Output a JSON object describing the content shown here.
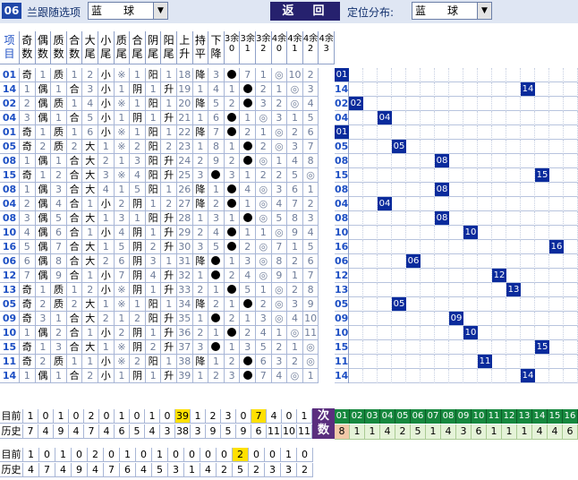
{
  "toolbar": {
    "num": "06",
    "follow_label": "兰跟随选项",
    "follow_value": "蓝　　球",
    "back": "返　回",
    "pos_label": "定位分布:",
    "pos_value": "蓝　　球"
  },
  "headers": {
    "item": "项目",
    "cols": [
      "奇数",
      "偶数",
      "质数",
      "合数",
      "大尾",
      "小尾",
      "质尾",
      "合尾",
      "阴尾",
      "阳尾",
      "上升",
      "持平",
      "下降",
      "3余0",
      "3余1",
      "3余2",
      "4余0",
      "4余1",
      "4余2",
      "4余3"
    ],
    "right_item": "项目",
    "nums": [
      "01",
      "02",
      "03",
      "04",
      "05",
      "06",
      "07",
      "08",
      "09",
      "10",
      "11",
      "12",
      "13",
      "14",
      "15",
      "16"
    ]
  },
  "rows": [
    {
      "n": "01",
      "v": [
        "奇",
        "1",
        "质",
        "1",
        "2",
        "小",
        "※",
        "1",
        "阳",
        "1",
        "18",
        "降",
        "3",
        "●",
        "7",
        "1",
        "◎",
        "10",
        "2"
      ],
      "m": 1
    },
    {
      "n": "14",
      "v": [
        "1",
        "偶",
        "1",
        "合",
        "3",
        "小",
        "1",
        "阴",
        "1",
        "升",
        "19",
        "1",
        "4",
        "1",
        "●",
        "2",
        "1",
        "◎",
        "3"
      ],
      "m": 14
    },
    {
      "n": "02",
      "v": [
        "2",
        "偶",
        "质",
        "1",
        "4",
        "小",
        "※",
        "1",
        "阳",
        "1",
        "20",
        "降",
        "5",
        "2",
        "●",
        "3",
        "2",
        "◎",
        "4"
      ],
      "m": 2
    },
    {
      "n": "04",
      "v": [
        "3",
        "偶",
        "1",
        "合",
        "5",
        "小",
        "1",
        "阴",
        "1",
        "升",
        "21",
        "1",
        "6",
        "●",
        "1",
        "◎",
        "3",
        "1",
        "5"
      ],
      "m": 4
    },
    {
      "n": "01",
      "v": [
        "奇",
        "1",
        "质",
        "1",
        "6",
        "小",
        "※",
        "1",
        "阳",
        "1",
        "22",
        "降",
        "7",
        "●",
        "2",
        "1",
        "◎",
        "2",
        "6"
      ],
      "m": 1
    },
    {
      "n": "05",
      "v": [
        "奇",
        "2",
        "质",
        "2",
        "大",
        "1",
        "※",
        "2",
        "阳",
        "2",
        "23",
        "1",
        "8",
        "1",
        "●",
        "2",
        "◎",
        "3",
        "7"
      ],
      "m": 5
    },
    {
      "n": "08",
      "v": [
        "1",
        "偶",
        "1",
        "合",
        "大",
        "2",
        "1",
        "3",
        "阳",
        "升",
        "24",
        "2",
        "9",
        "2",
        "●",
        "◎",
        "1",
        "4",
        "8"
      ],
      "m": 8
    },
    {
      "n": "15",
      "v": [
        "奇",
        "1",
        "2",
        "合",
        "大",
        "3",
        "※",
        "4",
        "阳",
        "升",
        "25",
        "3",
        "●",
        "3",
        "1",
        "2",
        "2",
        "5",
        "◎"
      ],
      "m": 15
    },
    {
      "n": "08",
      "v": [
        "1",
        "偶",
        "3",
        "合",
        "大",
        "4",
        "1",
        "5",
        "阳",
        "1",
        "26",
        "降",
        "1",
        "●",
        "4",
        "◎",
        "3",
        "6",
        "1"
      ],
      "m": 8
    },
    {
      "n": "04",
      "v": [
        "2",
        "偶",
        "4",
        "合",
        "1",
        "小",
        "2",
        "阴",
        "1",
        "2",
        "27",
        "降",
        "2",
        "●",
        "1",
        "◎",
        "4",
        "7",
        "2"
      ],
      "m": 4
    },
    {
      "n": "08",
      "v": [
        "3",
        "偶",
        "5",
        "合",
        "大",
        "1",
        "3",
        "1",
        "阳",
        "升",
        "28",
        "1",
        "3",
        "1",
        "●",
        "◎",
        "5",
        "8",
        "3"
      ],
      "m": 8
    },
    {
      "n": "10",
      "v": [
        "4",
        "偶",
        "6",
        "合",
        "1",
        "小",
        "4",
        "阴",
        "1",
        "升",
        "29",
        "2",
        "4",
        "●",
        "1",
        "1",
        "◎",
        "9",
        "4"
      ],
      "m": 10
    },
    {
      "n": "16",
      "v": [
        "5",
        "偶",
        "7",
        "合",
        "大",
        "1",
        "5",
        "阴",
        "2",
        "升",
        "30",
        "3",
        "5",
        "●",
        "2",
        "◎",
        "7",
        "1",
        "5"
      ],
      "m": 16
    },
    {
      "n": "06",
      "v": [
        "6",
        "偶",
        "8",
        "合",
        "大",
        "2",
        "6",
        "阴",
        "3",
        "1",
        "31",
        "降",
        "●",
        "1",
        "3",
        "◎",
        "8",
        "2",
        "6"
      ],
      "m": 6
    },
    {
      "n": "12",
      "v": [
        "7",
        "偶",
        "9",
        "合",
        "1",
        "小",
        "7",
        "阴",
        "4",
        "升",
        "32",
        "1",
        "●",
        "2",
        "4",
        "◎",
        "9",
        "1",
        "7"
      ],
      "m": 12
    },
    {
      "n": "13",
      "v": [
        "奇",
        "1",
        "质",
        "1",
        "2",
        "小",
        "※",
        "阴",
        "1",
        "升",
        "33",
        "2",
        "1",
        "●",
        "5",
        "1",
        "◎",
        "2",
        "8"
      ],
      "m": 13
    },
    {
      "n": "05",
      "v": [
        "奇",
        "2",
        "质",
        "2",
        "大",
        "1",
        "※",
        "1",
        "阳",
        "1",
        "34",
        "降",
        "2",
        "1",
        "●",
        "2",
        "◎",
        "3",
        "9"
      ],
      "m": 5
    },
    {
      "n": "09",
      "v": [
        "奇",
        "3",
        "1",
        "合",
        "大",
        "2",
        "1",
        "2",
        "阳",
        "升",
        "35",
        "1",
        "●",
        "2",
        "1",
        "3",
        "◎",
        "4",
        "10"
      ],
      "m": 9
    },
    {
      "n": "10",
      "v": [
        "1",
        "偶",
        "2",
        "合",
        "1",
        "小",
        "2",
        "阴",
        "1",
        "升",
        "36",
        "2",
        "1",
        "●",
        "2",
        "4",
        "1",
        "◎",
        "11"
      ],
      "m": 10
    },
    {
      "n": "15",
      "v": [
        "奇",
        "1",
        "3",
        "合",
        "大",
        "1",
        "※",
        "阴",
        "2",
        "升",
        "37",
        "3",
        "●",
        "1",
        "3",
        "5",
        "2",
        "1",
        "◎"
      ],
      "m": 15
    },
    {
      "n": "11",
      "v": [
        "奇",
        "2",
        "质",
        "1",
        "1",
        "小",
        "※",
        "2",
        "阳",
        "1",
        "38",
        "降",
        "1",
        "2",
        "●",
        "6",
        "3",
        "2",
        "◎"
      ],
      "m": 11
    },
    {
      "n": "14",
      "v": [
        "1",
        "偶",
        "1",
        "合",
        "2",
        "小",
        "1",
        "阴",
        "1",
        "升",
        "39",
        "1",
        "2",
        "3",
        "●",
        "7",
        "4",
        "◎",
        "1"
      ],
      "m": 14
    }
  ],
  "footer1": {
    "label1": "目前",
    "label2": "历史",
    "now": [
      "1",
      "0",
      "1",
      "0",
      "2",
      "0",
      "1",
      "0",
      "1",
      "0",
      "39",
      "1",
      "2",
      "3",
      "0",
      "7",
      "4",
      "0",
      "1"
    ],
    "hist": [
      "7",
      "4",
      "9",
      "4",
      "7",
      "4",
      "6",
      "5",
      "4",
      "3",
      "38",
      "3",
      "9",
      "5",
      "9",
      "6",
      "11",
      "10",
      "11"
    ],
    "cishu": "次数",
    "nums": [
      "01",
      "02",
      "03",
      "04",
      "05",
      "06",
      "07",
      "08",
      "09",
      "10",
      "11",
      "12",
      "13",
      "14",
      "15",
      "16"
    ],
    "counts": [
      "8",
      "1",
      "1",
      "4",
      "2",
      "5",
      "1",
      "4",
      "3",
      "6",
      "1",
      "1",
      "1",
      "4",
      "4",
      "6"
    ]
  },
  "footer2": {
    "label1": "目前",
    "label2": "历史",
    "now": [
      "1",
      "0",
      "1",
      "0",
      "2",
      "0",
      "1",
      "0",
      "1",
      "0",
      "0",
      "0",
      "0",
      "2",
      "0",
      "0",
      "1",
      "0"
    ],
    "hist": [
      "4",
      "7",
      "4",
      "9",
      "4",
      "7",
      "6",
      "4",
      "5",
      "3",
      "1",
      "4",
      "2",
      "5",
      "2",
      "3",
      "3",
      "2"
    ]
  }
}
